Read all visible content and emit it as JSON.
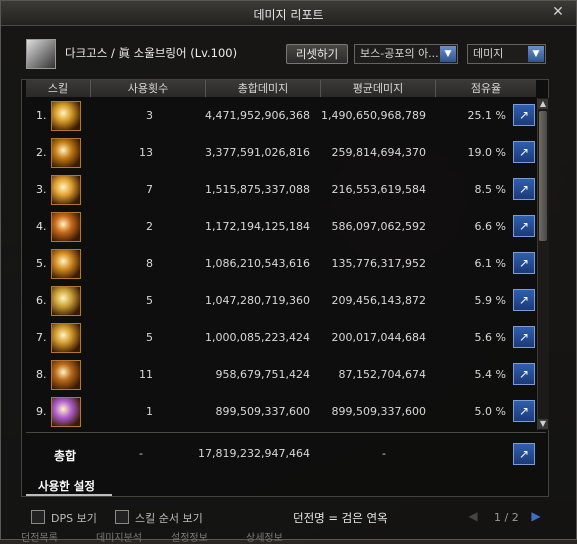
{
  "window": {
    "title": "데미지 리포트"
  },
  "character": {
    "name": "다크고스 / 眞 소울브링어 (Lv.100)"
  },
  "toolbar": {
    "reset_label": "리셋하기",
    "boss_filter": "보스-공포의 아...",
    "type_filter": "데미지"
  },
  "table": {
    "headers": [
      "스킬",
      "사용횟수",
      "총합데미지",
      "평균데미지",
      "점유율"
    ],
    "rows": [
      {
        "no": "1.",
        "uses": "3",
        "total": "4,471,952,906,368",
        "avg": "1,490,650,968,789",
        "share": "25.1 %"
      },
      {
        "no": "2.",
        "uses": "13",
        "total": "3,377,591,026,816",
        "avg": "259,814,694,370",
        "share": "19.0 %"
      },
      {
        "no": "3.",
        "uses": "7",
        "total": "1,515,875,337,088",
        "avg": "216,553,619,584",
        "share": "8.5 %"
      },
      {
        "no": "4.",
        "uses": "2",
        "total": "1,172,194,125,184",
        "avg": "586,097,062,592",
        "share": "6.6 %"
      },
      {
        "no": "5.",
        "uses": "8",
        "total": "1,086,210,543,616",
        "avg": "135,776,317,952",
        "share": "6.1 %"
      },
      {
        "no": "6.",
        "uses": "5",
        "total": "1,047,280,719,360",
        "avg": "209,456,143,872",
        "share": "5.9 %"
      },
      {
        "no": "7.",
        "uses": "5",
        "total": "1,000,085,223,424",
        "avg": "200,017,044,684",
        "share": "5.6 %"
      },
      {
        "no": "8.",
        "uses": "11",
        "total": "958,679,751,424",
        "avg": "87,152,704,674",
        "share": "5.4 %"
      },
      {
        "no": "9.",
        "uses": "1",
        "total": "899,509,337,600",
        "avg": "899,509,337,600",
        "share": "5.0 %"
      }
    ]
  },
  "summary": {
    "label": "총합",
    "uses": "-",
    "total": "17,819,232,947,464",
    "avg": "-"
  },
  "settings_tab": "사용한 설정",
  "footer": {
    "dps_label": "DPS 보기",
    "skill_order_label": "스킬 순서 보기",
    "legend": "던전명 = 검은 연옥",
    "page": "1 / 2"
  },
  "bottom_tabs": [
    "던전목록",
    "데미지분석",
    "설정정보",
    "상세정보"
  ],
  "icons": {
    "close": "close-icon",
    "dropdown": "chevron-down-icon",
    "share": "export-icon",
    "skill_colors": [
      "#d49a25",
      "#c27a15",
      "#e0a030",
      "#c86a18",
      "#d28a20",
      "#caa035",
      "#d0982a",
      "#b86818",
      "#b060d0"
    ]
  }
}
